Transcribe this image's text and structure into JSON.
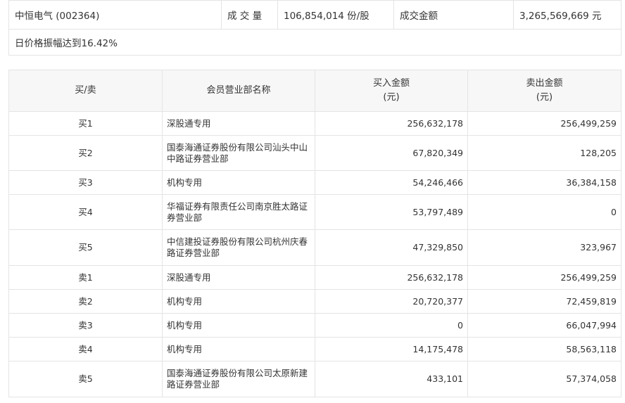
{
  "summary": {
    "stock_name": "中恒电气 (002364)",
    "volume_label": "成 交 量",
    "volume_value": "106,854,014 份/股",
    "amount_label": "成交金额",
    "amount_value": "3,265,569,669 元",
    "note": "日价格振幅达到16.42%"
  },
  "table": {
    "headers": {
      "type": "买/卖",
      "member": "会员营业部名称",
      "buy": "买入金额",
      "buy_unit": "(元)",
      "sell": "卖出金额",
      "sell_unit": "(元)"
    },
    "rows": [
      {
        "type": "买1",
        "name": "深股通专用",
        "buy": "256,632,178",
        "sell": "256,499,259"
      },
      {
        "type": "买2",
        "name": "国泰海通证券股份有限公司汕头中山中路证券营业部",
        "buy": "67,820,349",
        "sell": "128,205"
      },
      {
        "type": "买3",
        "name": "机构专用",
        "buy": "54,246,466",
        "sell": "36,384,158"
      },
      {
        "type": "买4",
        "name": "华福证券有限责任公司南京胜太路证券营业部",
        "buy": "53,797,489",
        "sell": "0"
      },
      {
        "type": "买5",
        "name": "中信建投证券股份有限公司杭州庆春路证券营业部",
        "buy": "47,329,850",
        "sell": "323,967"
      },
      {
        "type": "卖1",
        "name": "深股通专用",
        "buy": "256,632,178",
        "sell": "256,499,259"
      },
      {
        "type": "卖2",
        "name": "机构专用",
        "buy": "20,720,377",
        "sell": "72,459,819"
      },
      {
        "type": "卖3",
        "name": "机构专用",
        "buy": "0",
        "sell": "66,047,994"
      },
      {
        "type": "卖4",
        "name": "机构专用",
        "buy": "14,175,478",
        "sell": "58,563,118"
      },
      {
        "type": "卖5",
        "name": "国泰海通证券股份有限公司太原新建路证券营业部",
        "buy": "433,101",
        "sell": "57,374,058"
      }
    ]
  }
}
